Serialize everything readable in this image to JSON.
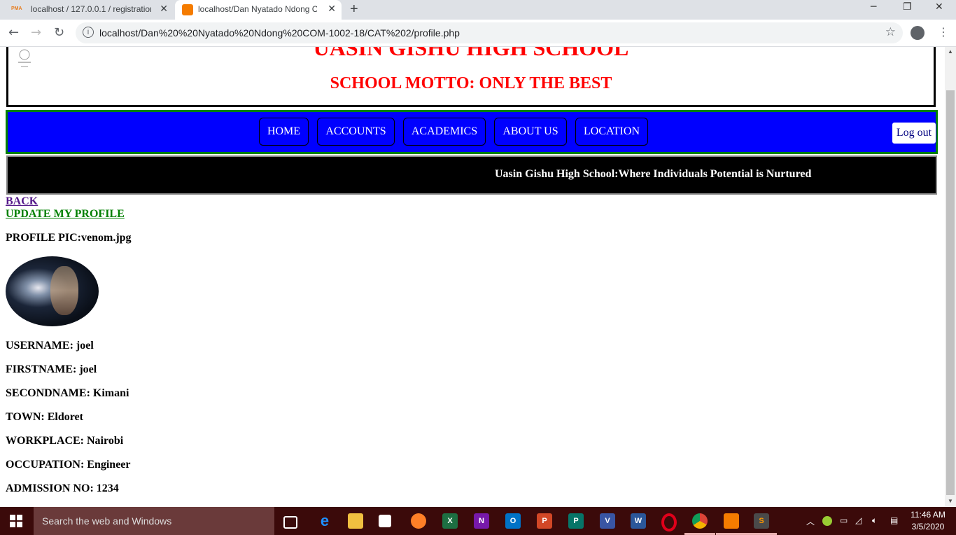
{
  "browser": {
    "tabs": [
      {
        "label": "localhost / 127.0.0.1 / registration",
        "active": false
      },
      {
        "label": "localhost/Dan  Nyatado Ndong C",
        "active": true
      }
    ],
    "url": "localhost/Dan%20%20Nyatado%20Ndong%20COM-1002-18/CAT%202/profile.php"
  },
  "page": {
    "school_name": "UASIN GISHU HIGH SCHOOL",
    "motto": "SCHOOL MOTTO: ONLY THE BEST",
    "nav": [
      "HOME",
      "ACCOUNTS",
      "ACADEMICS",
      "ABOUT US",
      "LOCATION"
    ],
    "logout_label": "Log out",
    "marquee": "Uasin Gishu High School:Where Individuals Potential is Nurtured",
    "back_link": "BACK",
    "update_link": "UPDATE MY PROFILE",
    "profile_pic": "PROFILE PIC:venom.jpg",
    "fields": [
      "USERNAME: joel",
      "FIRSTNAME: joel",
      "SECONDNAME: Kimani",
      "TOWN: Eldoret",
      "WORKPLACE: Nairobi",
      "OCCUPATION: Engineer",
      "ADMISSION NO: 1234"
    ]
  },
  "taskbar": {
    "search_placeholder": "Search the web and Windows",
    "time": "11:46 AM",
    "date": "3/5/2020"
  },
  "colors": {
    "header_text": "#ff0000",
    "navbar_bg": "#0000ff",
    "navbar_border": "#008000",
    "marquee_bg": "#000000"
  }
}
